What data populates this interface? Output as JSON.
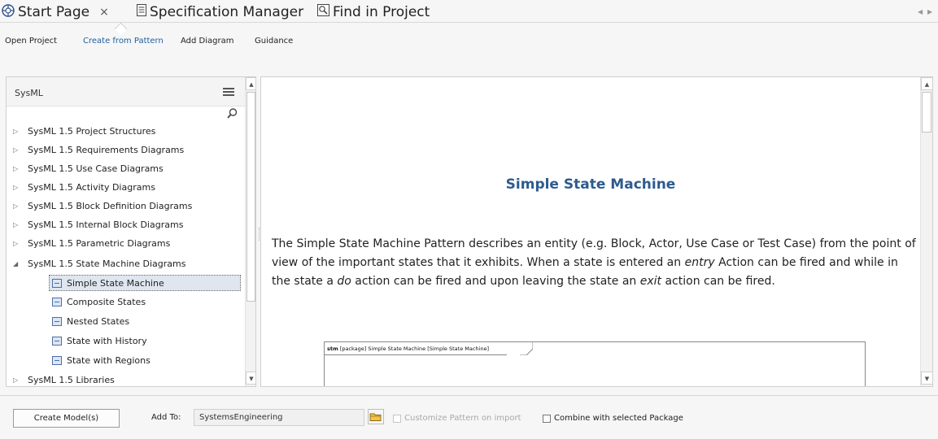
{
  "tabs": [
    {
      "label": "Start Page",
      "icon": "start-page-icon"
    },
    {
      "label": "Specification Manager",
      "icon": "spec-doc-icon"
    },
    {
      "label": "Find in Project",
      "icon": "find-icon"
    }
  ],
  "close_glyph": "×",
  "sublinks": [
    "Open Project",
    "Create from Pattern",
    "Add Diagram",
    "Guidance"
  ],
  "tree": {
    "title": "SysML",
    "items": [
      {
        "label": "SysML 1.5 Project Structures",
        "state": "collapsed"
      },
      {
        "label": "SysML 1.5 Requirements Diagrams",
        "state": "collapsed"
      },
      {
        "label": "SysML 1.5 Use Case Diagrams",
        "state": "collapsed"
      },
      {
        "label": "SysML 1.5 Activity Diagrams",
        "state": "collapsed"
      },
      {
        "label": "SysML 1.5 Block Definition Diagrams",
        "state": "collapsed"
      },
      {
        "label": "SysML 1.5 Internal Block Diagrams",
        "state": "collapsed"
      },
      {
        "label": "SysML 1.5 Parametric Diagrams",
        "state": "collapsed"
      },
      {
        "label": "SysML 1.5 State Machine Diagrams",
        "state": "expanded"
      },
      {
        "label": "Simple State Machine",
        "state": "leaf",
        "selected": true
      },
      {
        "label": "Composite States",
        "state": "leaf"
      },
      {
        "label": "Nested States",
        "state": "leaf"
      },
      {
        "label": "State with History",
        "state": "leaf"
      },
      {
        "label": "State with Regions",
        "state": "leaf"
      },
      {
        "label": "SysML 1.5 Libraries",
        "state": "collapsed"
      }
    ]
  },
  "preview": {
    "title": "Simple State Machine",
    "desc_1": "The Simple State Machine Pattern describes an entity (e.g. Block, Actor, Use Case or Test Case) from the point of view of the important states that it exhibits. When a state is entered an ",
    "desc_em1": "entry",
    "desc_2": " Action can be fired and while in the state a ",
    "desc_em2": "do",
    "desc_3": " action can be fired and upon leaving the state an ",
    "desc_em3": "exit",
    "desc_4": " action can be fired.",
    "diagram_kind": "stm",
    "diagram_label": " [package] Simple State Machine [Simple State Machine]"
  },
  "bottom": {
    "create_button": "Create Model(s)",
    "add_to_label": "Add To:",
    "add_to_value": "SystemsEngineering",
    "customize_label": "Customize Pattern on import",
    "customize_checked": false,
    "customize_enabled": false,
    "combine_label": "Combine with selected Package",
    "combine_checked": false
  },
  "colors": {
    "accent": "#2d5b8f",
    "active_link": "#1f5f9e",
    "selection": "#dfe6ef"
  }
}
